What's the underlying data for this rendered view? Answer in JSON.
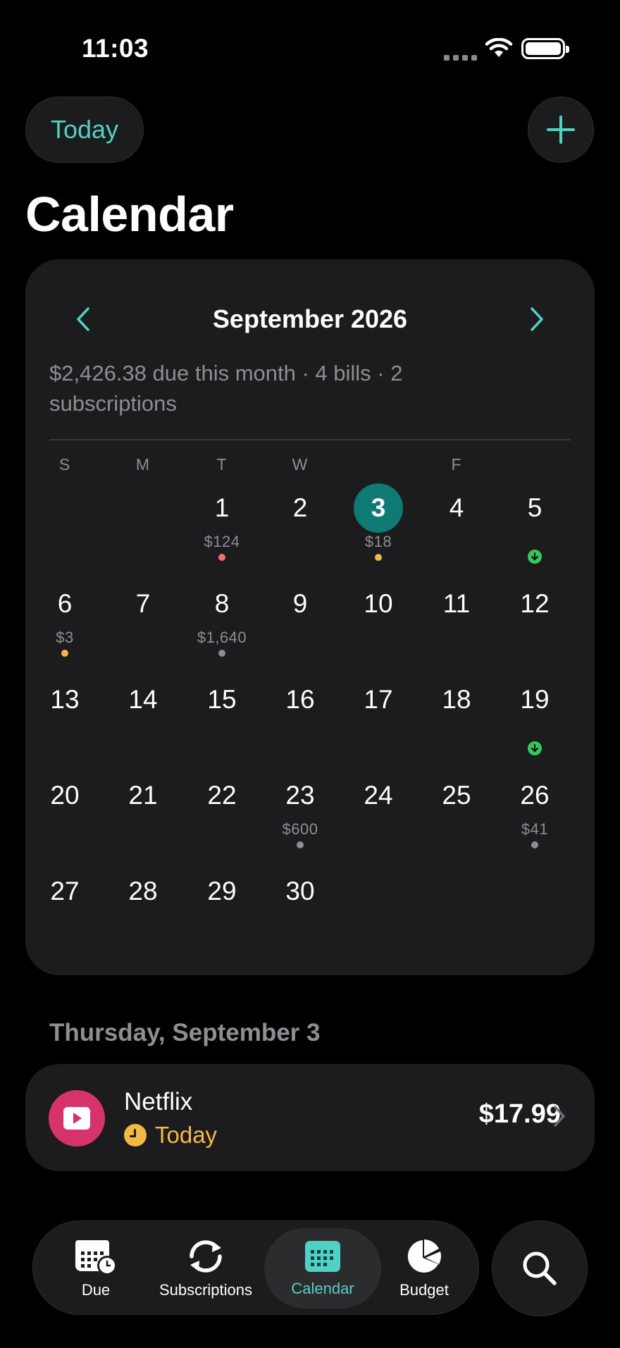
{
  "status_bar": {
    "time": "11:03"
  },
  "header": {
    "today_label": "Today",
    "title": "Calendar"
  },
  "calendar": {
    "month_label": "September 2026",
    "summary": "$2,426.38 due this month · 4 bills · 2 subscriptions",
    "weekdays": [
      "S",
      "M",
      "T",
      "W",
      "",
      "F",
      ""
    ],
    "selected_day": 3,
    "days": [
      {
        "num": "1",
        "amount": "$124",
        "marker": "red"
      },
      {
        "num": "2"
      },
      {
        "num": "3",
        "amount": "$18",
        "marker": "orange",
        "selected": true
      },
      {
        "num": "4"
      },
      {
        "num": "5",
        "marker": "income"
      },
      {
        "num": "6",
        "amount": "$3",
        "marker": "orange"
      },
      {
        "num": "7"
      },
      {
        "num": "8",
        "amount": "$1,640",
        "marker": "gray"
      },
      {
        "num": "9"
      },
      {
        "num": "10"
      },
      {
        "num": "11"
      },
      {
        "num": "12"
      },
      {
        "num": "13"
      },
      {
        "num": "14"
      },
      {
        "num": "15"
      },
      {
        "num": "16"
      },
      {
        "num": "17"
      },
      {
        "num": "18"
      },
      {
        "num": "19",
        "marker": "income"
      },
      {
        "num": "20"
      },
      {
        "num": "21"
      },
      {
        "num": "22"
      },
      {
        "num": "23",
        "amount": "$600",
        "marker": "gray"
      },
      {
        "num": "24"
      },
      {
        "num": "25"
      },
      {
        "num": "26",
        "amount": "$41",
        "marker": "gray"
      },
      {
        "num": "27"
      },
      {
        "num": "28"
      },
      {
        "num": "29"
      },
      {
        "num": "30"
      }
    ],
    "first_weekday_index": 2
  },
  "selected_date_title": "Thursday, September 3",
  "bill": {
    "name": "Netflix",
    "due": "Today",
    "amount": "$17.99",
    "icon": "play-icon",
    "color": "#d6336c"
  },
  "tabs": [
    {
      "label": "Due",
      "icon": "calendar-clock-icon"
    },
    {
      "label": "Subscriptions",
      "icon": "refresh-icon"
    },
    {
      "label": "Calendar",
      "icon": "calendar-grid-icon",
      "active": true
    },
    {
      "label": "Budget",
      "icon": "pie-chart-icon"
    }
  ],
  "colors": {
    "accent": "#4fd1c5",
    "selected": "#0f7a73",
    "warning": "#f5b841",
    "danger": "#ff6b6b",
    "income": "#34c759"
  }
}
